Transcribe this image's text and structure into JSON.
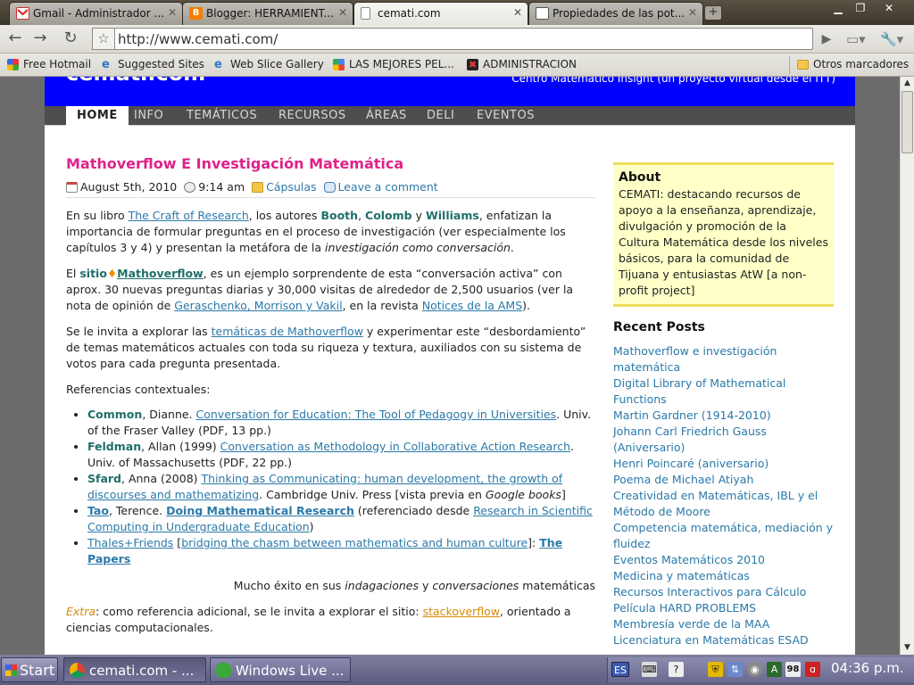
{
  "browser": {
    "tabs": [
      {
        "label": "Gmail - Administrador ...",
        "icon": "gmail-icon",
        "active": false
      },
      {
        "label": "Blogger: HERRAMIENT...",
        "icon": "blogger-icon",
        "active": false
      },
      {
        "label": "cemati.com",
        "icon": "page-icon",
        "active": true
      },
      {
        "label": "Propiedades de las pot...",
        "icon": "page-icon",
        "active": false
      }
    ],
    "url": "http://www.cemati.com/",
    "bookmarks": [
      {
        "label": "Free Hotmail",
        "icon": "windows-icon"
      },
      {
        "label": "Suggested Sites",
        "icon": "ie-icon"
      },
      {
        "label": "Web Slice Gallery",
        "icon": "ie-icon"
      },
      {
        "label": "LAS MEJORES PEL...",
        "icon": "google-icon"
      },
      {
        "label": "ADMINISTRACION",
        "icon": "admin-icon"
      }
    ],
    "other_bookmarks": "Otros marcadores"
  },
  "site": {
    "title": "cemati.com",
    "tagline": "Centro Matemático Insight (un proyecto virtual desde el ITT)",
    "nav": [
      "HOME",
      "INFO",
      "TEMÁTICOS",
      "RECURSOS",
      "ÁREAS",
      "DELI",
      "EVENTOS"
    ]
  },
  "post": {
    "title": "Mathoverflow E Investigación Matemática",
    "date": "August 5th, 2010",
    "time": "9:14 am",
    "category": "Cápsulas",
    "comment_link": "Leave a comment",
    "p1": {
      "t1": "En su libro ",
      "link1": "The Craft of Research",
      "t2": ", los autores ",
      "a1": "Booth",
      "t3": ", ",
      "a2": "Colomb",
      "t4": " y ",
      "a3": "Williams",
      "t5": ", enfatizan la importancia de formular preguntas en el proceso de investigación (ver especialmente los capítulos 3 y 4) y presentan la metáfora de la ",
      "em": "investigación como conversación",
      "t6": "."
    },
    "p2": {
      "t1": "El ",
      "link_sitio": "sitio",
      "diamond": "♦",
      "link_mo": "Mathoverflow",
      "t2": ", es un ejemplo sorprendente de esta “conversación activa” con aprox. 30 nuevas preguntas diarias y 30,000 visitas de alrededor de 2,500 usuarios (ver la nota de opinión de ",
      "link2": "Geraschenko, Morrison y Vakil",
      "t3": ", en la revista ",
      "link3": "Notices de la AMS",
      "t4": ")."
    },
    "p3": {
      "t1": "Se le invita a explorar las ",
      "link1": "temáticas de Mathoverflow",
      "t2": " y experimentar este “desbordamiento” de temas matemáticos actuales con toda su riqueza y textura, auxiliados con su sistema de votos para cada pregunta presentada."
    },
    "refs_heading": "Referencias contextuales:",
    "refs": [
      {
        "author": "Common",
        "t1": ", Dianne. ",
        "link": "Conversation for Education: The Tool of Pedagogy in Universities",
        "t2": ". Univ. of the Fraser Valley (PDF, 13 pp.)"
      },
      {
        "author": "Feldman",
        "t1": ", Allan (1999) ",
        "link": "Conversation as Methodology in Collaborative Action Research",
        "t2": ". Univ. of Massachusetts (PDF, 22 pp.)"
      },
      {
        "author": "Sfard",
        "t1": ", Anna (2008) ",
        "link": "Thinking as Communicating: human development, the growth of discourses and mathematizing",
        "t2": ". Cambridge Univ. Press [vista previa en ",
        "em": "Google books",
        "t3": "]"
      },
      {
        "author": "Tao",
        "t1": ", Terence. ",
        "link_bold": "Doing Mathematical Research",
        "t2": " (referenciado desde ",
        "link": "Research in Scientific Computing in Undergraduate Education",
        "t3": ")"
      },
      {
        "link_a": "Thales+Friends",
        "t1": " [",
        "link_b": "bridging the chasm between mathematics and human culture",
        "t2": "]: ",
        "link_c": "The Papers"
      }
    ],
    "closing": {
      "t1": "Mucho éxito en sus ",
      "em1": "indagaciones",
      "t2": " y ",
      "em2": "conversaciones",
      "t3": " matemáticas"
    },
    "extra": {
      "label": "Extra",
      "t1": ": como referencia adicional, se le invita a explorar el sitio: ",
      "link": "stackoverflow",
      "t2": ", orientado a ciencias computacionales."
    }
  },
  "sidebar": {
    "about_title": "About",
    "about_text": "CEMATI: destacando recursos de apoyo a la enseñanza, aprendizaje, divulgación y promoción de la Cultura Matemática desde los niveles básicos, para la comunidad de Tijuana y entusiastas AtW [a non-profit project]",
    "recent_title": "Recent Posts",
    "recent": [
      "Mathoverflow e investigación matemática",
      "Digital Library of Mathematical Functions",
      "Martin Gardner (1914-2010)",
      "Johann Carl Friedrich Gauss (Aniversario)",
      "Henri Poincaré (aniversario)",
      "Poema de Michael Atiyah",
      "Creatividad en Matemáticas, IBL y el Método de Moore",
      "Competencia matemática, mediación y fluidez",
      "Eventos Matemáticos 2010",
      "Medicina y matemáticas",
      "Recursos Interactivos para Cálculo",
      "Película HARD PROBLEMS",
      "Membresía verde de la MAA",
      "Licenciatura en Matemáticas ESAD"
    ]
  },
  "taskbar": {
    "start": "Start",
    "tasks": [
      {
        "label": "cemati.com - ...",
        "icon": "chrome-icon",
        "active": true
      },
      {
        "label": "Windows Live ...",
        "icon": "messenger-icon",
        "active": false
      }
    ],
    "lang": "ES",
    "badge": "98",
    "clock": "04:36 p.m."
  },
  "colors": {
    "post_title": "#e0218a",
    "link": "#2b79a8",
    "header_blue": "#0000ff",
    "about_bg": "#ffffc8"
  }
}
